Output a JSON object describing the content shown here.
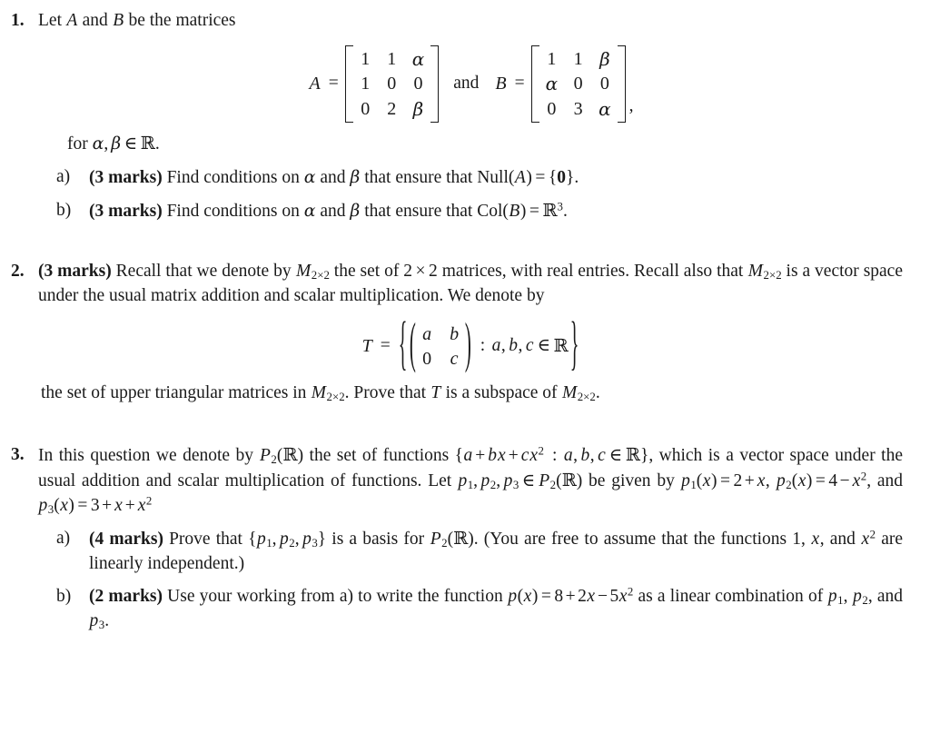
{
  "document": {
    "type": "linear-algebra-problem-set",
    "background_color": "#ffffff",
    "text_color": "#1a1a1a"
  },
  "problems": [
    {
      "number": "1.",
      "intro": {
        "pre": "Let ",
        "var_a": "A",
        "mid": " and ",
        "var_b": "B",
        "post": " be the matrices"
      },
      "equation": {
        "label_a": "A",
        "equals": "=",
        "matrix_a": {
          "bracket": "square",
          "rows": [
            [
              "1",
              "1",
              "α"
            ],
            [
              "1",
              "0",
              "0"
            ],
            [
              "0",
              "2",
              "β"
            ]
          ]
        },
        "conjunction": "and",
        "label_b": "B",
        "matrix_b": {
          "bracket": "square",
          "rows": [
            [
              "1",
              "1",
              "β"
            ],
            [
              "α",
              "0",
              "0"
            ],
            [
              "0",
              "3",
              "α"
            ]
          ]
        },
        "trailing_comma": ","
      },
      "for_line": {
        "pre": "for ",
        "alpha": "α",
        "comma": ",",
        "beta": "β",
        "in": "∈",
        "reals": "ℝ",
        "period": "."
      },
      "subparts": [
        {
          "label": "a)",
          "marks": "(3 marks)",
          "text_1": " Find conditions on ",
          "alpha": "α",
          "text_2": " and ",
          "beta": "β",
          "text_3": " that ensure that ",
          "operator": "Null",
          "arg": "A",
          "equals": "=",
          "result_open": "{",
          "result_value": "0",
          "result_close": "}",
          "period": "."
        },
        {
          "label": "b)",
          "marks": "(3 marks)",
          "text_1": " Find conditions on ",
          "alpha": "α",
          "text_2": " and ",
          "beta": "β",
          "text_3": " that ensure that ",
          "operator": "Col",
          "arg": "B",
          "equals": "=",
          "reals": "ℝ",
          "exponent": "3",
          "period": "."
        }
      ]
    },
    {
      "number": "2.",
      "marks": "(3 marks)",
      "body_1": " Recall that we denote by ",
      "space_m": "M",
      "space_m_sub": "2×2",
      "body_2": " the set of ",
      "dim_1": "2",
      "times": "×",
      "dim_2": "2",
      "body_3": " matrices, with real entries. Recall also that ",
      "space_m_2": "M",
      "space_m_2_sub": "2×2",
      "body_4": " is a vector space under the usual matrix addition and scalar multiplication. We denote by",
      "equation": {
        "label": "T",
        "equals": "=",
        "outer_open": "{",
        "matrix": {
          "bracket": "round",
          "rows": [
            [
              "a",
              "b"
            ],
            [
              "0",
              "c"
            ]
          ]
        },
        "colon": ":",
        "vars": [
          "a",
          "b",
          "c"
        ],
        "in": "∈",
        "reals": "ℝ",
        "outer_close": "}"
      },
      "tail_1": "the set of upper triangular matrices in ",
      "tail_m": "M",
      "tail_m_sub": "2×2",
      "tail_2": ". Prove that ",
      "tail_t": "T",
      "tail_3": " is a subspace of ",
      "tail_m2": "M",
      "tail_m2_sub": "2×2",
      "tail_period": "."
    },
    {
      "number": "3.",
      "body_1": "In this question we denote by ",
      "p2": "P",
      "p2_sub": "2",
      "p2_reals": "ℝ",
      "body_2": " the set of functions ",
      "set_open": "{",
      "set_a": "a",
      "set_plus1": "+",
      "set_b": "b",
      "set_x1": "x",
      "set_plus2": "+",
      "set_c": "c",
      "set_x2": "x",
      "set_exp": "2",
      "set_colon": ":",
      "set_vars": [
        "a",
        "b",
        "c"
      ],
      "set_in": "∈",
      "set_reals": "ℝ",
      "set_close": "}",
      "body_3": ", which is a vector space under the usual addition and scalar multiplication of functions. Let ",
      "p_list": [
        "p",
        "p",
        "p"
      ],
      "p_list_subs": [
        "1",
        "2",
        "3"
      ],
      "body_in": "∈",
      "body_4_p2": "P",
      "body_4_p2_sub": "2",
      "body_4_reals": "ℝ",
      "body_5": " be given by ",
      "poly_1": {
        "name": "p",
        "sub": "1",
        "arg": "x",
        "equals": "=",
        "expr_const": "2",
        "expr_op": "+",
        "expr_x": "x"
      },
      "poly_sep_1": ", ",
      "poly_2": {
        "name": "p",
        "sub": "2",
        "arg": "x",
        "equals": "=",
        "expr_const": "4",
        "expr_op": "−",
        "expr_x": "x",
        "expr_exp": "2"
      },
      "poly_sep_2": ", and ",
      "poly_3": {
        "name": "p",
        "sub": "3",
        "arg": "x",
        "equals": "=",
        "expr_const": "3",
        "expr_op1": "+",
        "expr_x1": "x",
        "expr_op2": "+",
        "expr_x2": "x",
        "expr_exp": "2"
      },
      "subparts": [
        {
          "label": "a)",
          "marks": "(4 marks)",
          "text_1": " Prove that ",
          "set_open": "{",
          "basis": [
            "p",
            "p",
            "p"
          ],
          "basis_subs": [
            "1",
            "2",
            "3"
          ],
          "set_close": "}",
          "text_2": " is a basis for ",
          "p2": "P",
          "p2_sub": "2",
          "p2_reals": "ℝ",
          "text_3": ". (You are free to assume that the functions ",
          "fn_1": "1",
          "fn_sep1": ", ",
          "fn_x": "x",
          "fn_sep2": ", and ",
          "fn_x2": "x",
          "fn_x2_exp": "2",
          "text_4": " are linearly independent.)"
        },
        {
          "label": "b)",
          "marks": "(2 marks)",
          "text_1": " Use your working from a) to write the function ",
          "fn_p": "p",
          "fn_arg": "x",
          "fn_equals": "=",
          "fn_c0": "8",
          "fn_op1": "+",
          "fn_c1": "2",
          "fn_x1": "x",
          "fn_op2": "−",
          "fn_c2": "5",
          "fn_x2": "x",
          "fn_x2_exp": "2",
          "text_2": " as a linear combination of ",
          "combo": [
            "p",
            "p",
            "p"
          ],
          "combo_subs": [
            "1",
            "2",
            "3"
          ],
          "combo_sep1": ", ",
          "combo_sep2": ", and ",
          "period": "."
        }
      ]
    }
  ]
}
